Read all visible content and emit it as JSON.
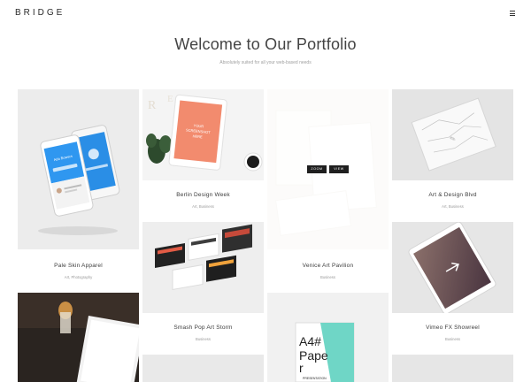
{
  "header": {
    "logo": "BRIDGE"
  },
  "hero": {
    "title": "Welcome to Our Portfolio",
    "subtitle": "Absolutely suited for all your web-based needs"
  },
  "portfolio": {
    "items": [
      {
        "title": "Pale Skin Apparel",
        "category": "Art, Photography"
      },
      {
        "title": "Berlin Design Week",
        "category": "Art, Business"
      },
      {
        "title": "Venice Art Pavilion",
        "category": "Business"
      },
      {
        "title": "Art & Design Blvd",
        "category": "Art, Business"
      },
      {
        "title": "Smash Pop Art Storm",
        "category": "Business"
      },
      {
        "title": "Vimeo FX Showreel",
        "category": "Business"
      }
    ],
    "ipad_text": "YOUR SCREENSHOT HERE",
    "hover_buttons": {
      "zoom": "ZOOM",
      "view": "VIEW"
    },
    "poster": {
      "line1": "A4#",
      "line2": "Pape",
      "line3": "r",
      "footer": "PRESENTATION"
    }
  }
}
